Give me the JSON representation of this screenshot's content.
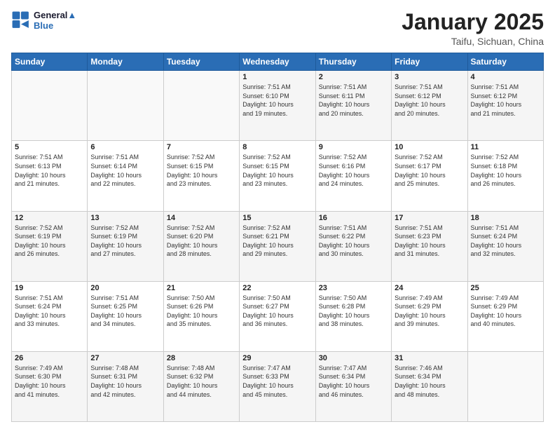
{
  "header": {
    "logo_line1": "General",
    "logo_line2": "Blue",
    "title": "January 2025",
    "subtitle": "Taifu, Sichuan, China"
  },
  "days_of_week": [
    "Sunday",
    "Monday",
    "Tuesday",
    "Wednesday",
    "Thursday",
    "Friday",
    "Saturday"
  ],
  "weeks": [
    [
      {
        "num": "",
        "info": ""
      },
      {
        "num": "",
        "info": ""
      },
      {
        "num": "",
        "info": ""
      },
      {
        "num": "1",
        "info": "Sunrise: 7:51 AM\nSunset: 6:10 PM\nDaylight: 10 hours\nand 19 minutes."
      },
      {
        "num": "2",
        "info": "Sunrise: 7:51 AM\nSunset: 6:11 PM\nDaylight: 10 hours\nand 20 minutes."
      },
      {
        "num": "3",
        "info": "Sunrise: 7:51 AM\nSunset: 6:12 PM\nDaylight: 10 hours\nand 20 minutes."
      },
      {
        "num": "4",
        "info": "Sunrise: 7:51 AM\nSunset: 6:12 PM\nDaylight: 10 hours\nand 21 minutes."
      }
    ],
    [
      {
        "num": "5",
        "info": "Sunrise: 7:51 AM\nSunset: 6:13 PM\nDaylight: 10 hours\nand 21 minutes."
      },
      {
        "num": "6",
        "info": "Sunrise: 7:51 AM\nSunset: 6:14 PM\nDaylight: 10 hours\nand 22 minutes."
      },
      {
        "num": "7",
        "info": "Sunrise: 7:52 AM\nSunset: 6:15 PM\nDaylight: 10 hours\nand 23 minutes."
      },
      {
        "num": "8",
        "info": "Sunrise: 7:52 AM\nSunset: 6:15 PM\nDaylight: 10 hours\nand 23 minutes."
      },
      {
        "num": "9",
        "info": "Sunrise: 7:52 AM\nSunset: 6:16 PM\nDaylight: 10 hours\nand 24 minutes."
      },
      {
        "num": "10",
        "info": "Sunrise: 7:52 AM\nSunset: 6:17 PM\nDaylight: 10 hours\nand 25 minutes."
      },
      {
        "num": "11",
        "info": "Sunrise: 7:52 AM\nSunset: 6:18 PM\nDaylight: 10 hours\nand 26 minutes."
      }
    ],
    [
      {
        "num": "12",
        "info": "Sunrise: 7:52 AM\nSunset: 6:19 PM\nDaylight: 10 hours\nand 26 minutes."
      },
      {
        "num": "13",
        "info": "Sunrise: 7:52 AM\nSunset: 6:19 PM\nDaylight: 10 hours\nand 27 minutes."
      },
      {
        "num": "14",
        "info": "Sunrise: 7:52 AM\nSunset: 6:20 PM\nDaylight: 10 hours\nand 28 minutes."
      },
      {
        "num": "15",
        "info": "Sunrise: 7:52 AM\nSunset: 6:21 PM\nDaylight: 10 hours\nand 29 minutes."
      },
      {
        "num": "16",
        "info": "Sunrise: 7:51 AM\nSunset: 6:22 PM\nDaylight: 10 hours\nand 30 minutes."
      },
      {
        "num": "17",
        "info": "Sunrise: 7:51 AM\nSunset: 6:23 PM\nDaylight: 10 hours\nand 31 minutes."
      },
      {
        "num": "18",
        "info": "Sunrise: 7:51 AM\nSunset: 6:24 PM\nDaylight: 10 hours\nand 32 minutes."
      }
    ],
    [
      {
        "num": "19",
        "info": "Sunrise: 7:51 AM\nSunset: 6:24 PM\nDaylight: 10 hours\nand 33 minutes."
      },
      {
        "num": "20",
        "info": "Sunrise: 7:51 AM\nSunset: 6:25 PM\nDaylight: 10 hours\nand 34 minutes."
      },
      {
        "num": "21",
        "info": "Sunrise: 7:50 AM\nSunset: 6:26 PM\nDaylight: 10 hours\nand 35 minutes."
      },
      {
        "num": "22",
        "info": "Sunrise: 7:50 AM\nSunset: 6:27 PM\nDaylight: 10 hours\nand 36 minutes."
      },
      {
        "num": "23",
        "info": "Sunrise: 7:50 AM\nSunset: 6:28 PM\nDaylight: 10 hours\nand 38 minutes."
      },
      {
        "num": "24",
        "info": "Sunrise: 7:49 AM\nSunset: 6:29 PM\nDaylight: 10 hours\nand 39 minutes."
      },
      {
        "num": "25",
        "info": "Sunrise: 7:49 AM\nSunset: 6:29 PM\nDaylight: 10 hours\nand 40 minutes."
      }
    ],
    [
      {
        "num": "26",
        "info": "Sunrise: 7:49 AM\nSunset: 6:30 PM\nDaylight: 10 hours\nand 41 minutes."
      },
      {
        "num": "27",
        "info": "Sunrise: 7:48 AM\nSunset: 6:31 PM\nDaylight: 10 hours\nand 42 minutes."
      },
      {
        "num": "28",
        "info": "Sunrise: 7:48 AM\nSunset: 6:32 PM\nDaylight: 10 hours\nand 44 minutes."
      },
      {
        "num": "29",
        "info": "Sunrise: 7:47 AM\nSunset: 6:33 PM\nDaylight: 10 hours\nand 45 minutes."
      },
      {
        "num": "30",
        "info": "Sunrise: 7:47 AM\nSunset: 6:34 PM\nDaylight: 10 hours\nand 46 minutes."
      },
      {
        "num": "31",
        "info": "Sunrise: 7:46 AM\nSunset: 6:34 PM\nDaylight: 10 hours\nand 48 minutes."
      },
      {
        "num": "",
        "info": ""
      }
    ]
  ]
}
